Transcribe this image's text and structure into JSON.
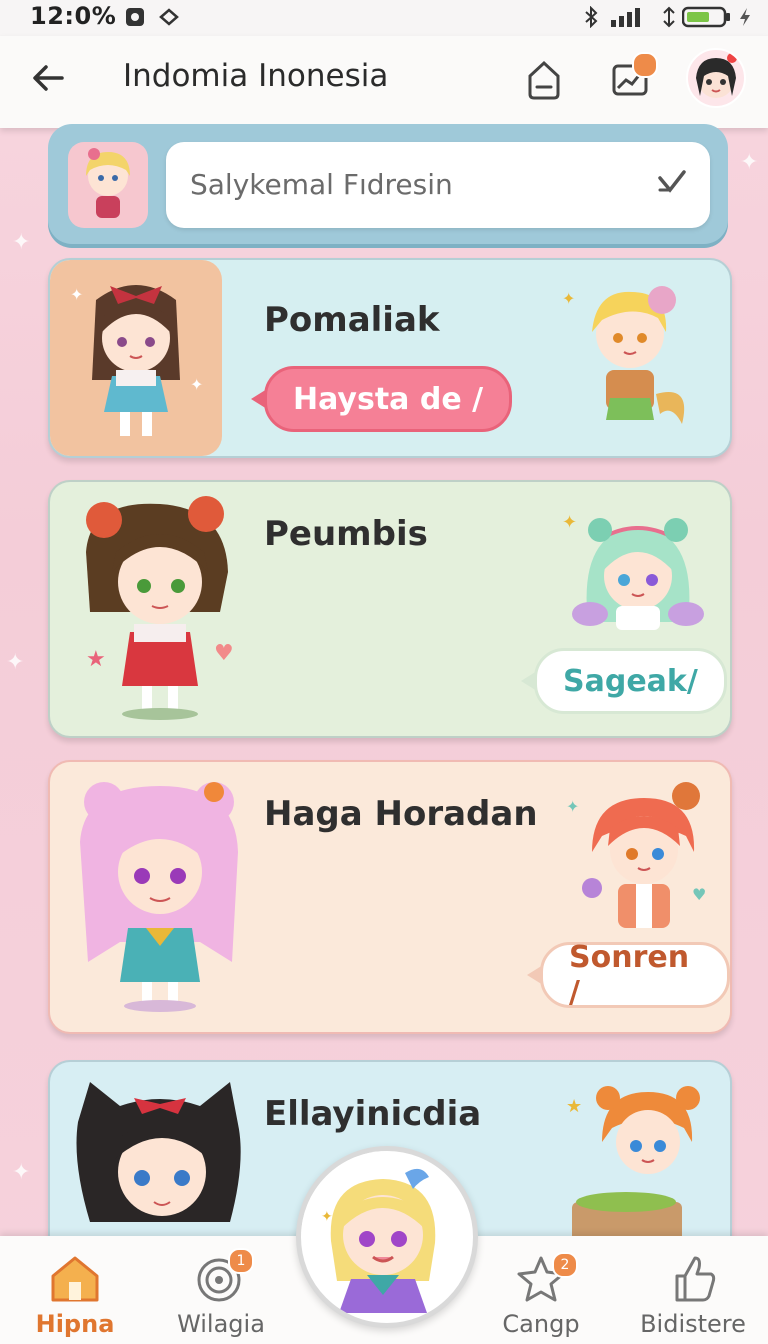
{
  "status_bar": {
    "time": "12:0%"
  },
  "app_bar": {
    "title": "Indomia Inonesia",
    "notification_badge": ""
  },
  "search": {
    "placeholder": "Salykemal Fıdresin"
  },
  "cards": [
    {
      "name": "Pomaliak",
      "action": "Haysta de /",
      "bg": "#d6eff1",
      "accent": "#e9637a"
    },
    {
      "name": "Peumbis",
      "action": "Sageak/",
      "bg": "#e4f0dc",
      "accent": "#3fa8a6"
    },
    {
      "name": "Haga Horadan",
      "action": "Sonren /",
      "bg": "#fbe9da",
      "accent": "#c0592e"
    },
    {
      "name": "Ellayinicdia",
      "action": "",
      "bg": "#d7eef3",
      "accent": "#3fa8a6"
    }
  ],
  "nav": [
    {
      "label": "Hipna",
      "icon": "home-icon",
      "active": true
    },
    {
      "label": "Wilagia",
      "icon": "target-icon",
      "badge": "1"
    },
    {
      "label": "Cangp",
      "icon": "star-icon",
      "badge": "2"
    },
    {
      "label": "Bidistere",
      "icon": "thumbs-up-icon"
    }
  ],
  "colors": {
    "accent": "#e0762f",
    "badge": "#ee8b49",
    "background": "#f6d2dc"
  }
}
